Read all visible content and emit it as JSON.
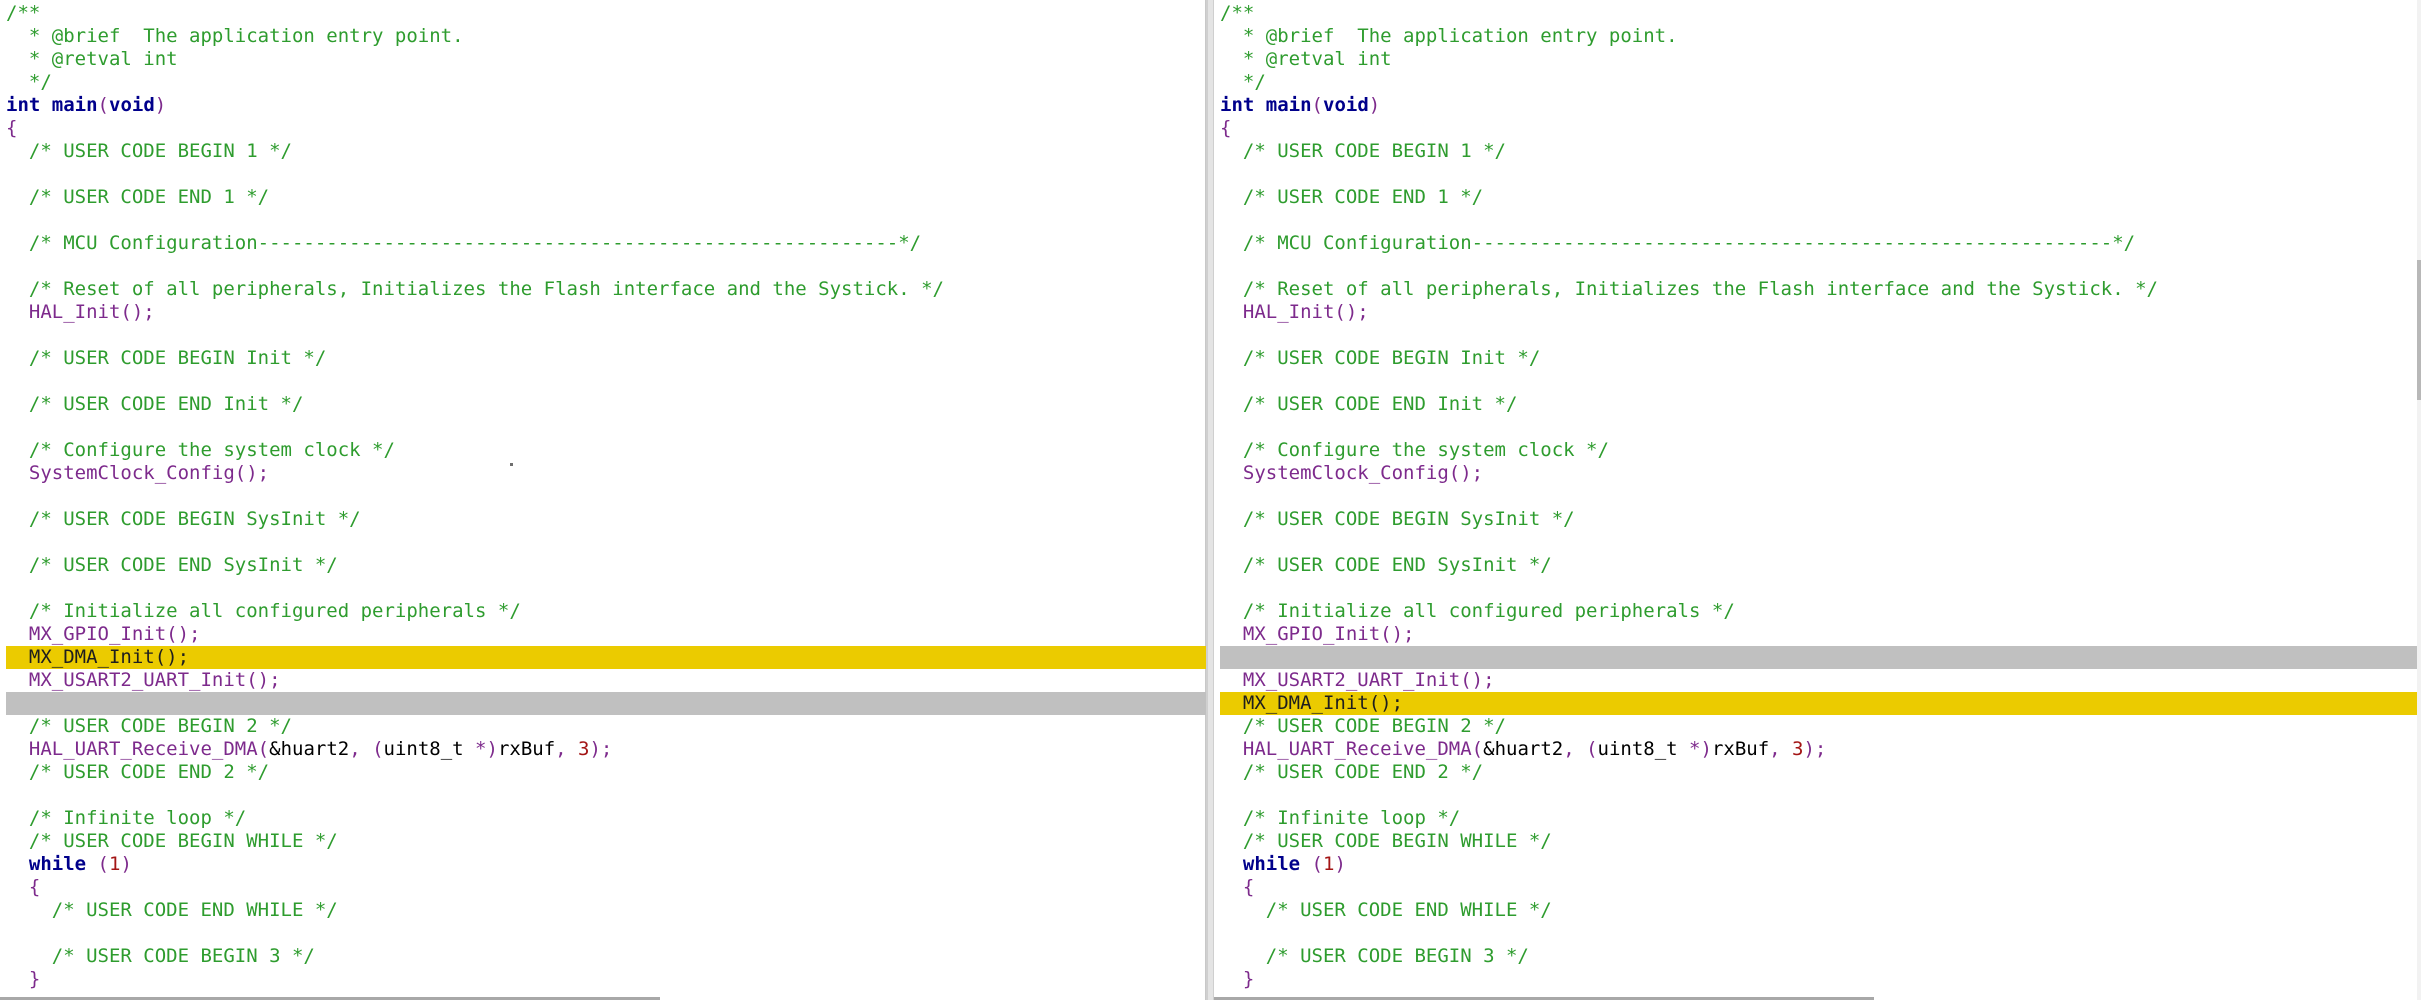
{
  "panes": [
    {
      "id": "left",
      "lines": [
        {
          "type": "normal",
          "tokens": [
            {
              "t": "comment",
              "v": "/**"
            }
          ]
        },
        {
          "type": "normal",
          "tokens": [
            {
              "t": "comment",
              "v": "  * @brief  The application entry point."
            }
          ]
        },
        {
          "type": "normal",
          "tokens": [
            {
              "t": "comment",
              "v": "  * @retval int"
            }
          ]
        },
        {
          "type": "normal",
          "tokens": [
            {
              "t": "comment",
              "v": "  */"
            }
          ]
        },
        {
          "type": "normal",
          "tokens": [
            {
              "t": "keyword",
              "v": "int"
            },
            {
              "t": "plain",
              "v": " "
            },
            {
              "t": "keyword",
              "v": "main"
            },
            {
              "t": "punct",
              "v": "("
            },
            {
              "t": "keyword",
              "v": "void"
            },
            {
              "t": "punct",
              "v": ")"
            }
          ]
        },
        {
          "type": "normal",
          "tokens": [
            {
              "t": "punct",
              "v": "{"
            }
          ]
        },
        {
          "type": "normal",
          "tokens": [
            {
              "t": "comment",
              "v": "  /* USER CODE BEGIN 1 */"
            }
          ]
        },
        {
          "type": "normal",
          "tokens": []
        },
        {
          "type": "normal",
          "tokens": [
            {
              "t": "comment",
              "v": "  /* USER CODE END 1 */"
            }
          ]
        },
        {
          "type": "normal",
          "tokens": []
        },
        {
          "type": "normal",
          "tokens": [
            {
              "t": "comment",
              "v": "  /* MCU Configuration--------------------------------------------------------*/"
            }
          ]
        },
        {
          "type": "normal",
          "tokens": []
        },
        {
          "type": "normal",
          "tokens": [
            {
              "t": "comment",
              "v": "  /* Reset of all peripherals, Initializes the Flash interface and the Systick. */"
            }
          ]
        },
        {
          "type": "normal",
          "tokens": [
            {
              "t": "plain",
              "v": "  "
            },
            {
              "t": "func",
              "v": "HAL_Init"
            },
            {
              "t": "punct",
              "v": "();"
            }
          ]
        },
        {
          "type": "normal",
          "tokens": []
        },
        {
          "type": "normal",
          "tokens": [
            {
              "t": "comment",
              "v": "  /* USER CODE BEGIN Init */"
            }
          ]
        },
        {
          "type": "normal",
          "tokens": []
        },
        {
          "type": "normal",
          "tokens": [
            {
              "t": "comment",
              "v": "  /* USER CODE END Init */"
            }
          ]
        },
        {
          "type": "normal",
          "tokens": []
        },
        {
          "type": "normal",
          "tokens": [
            {
              "t": "comment",
              "v": "  /* Configure the system clock */"
            }
          ]
        },
        {
          "type": "normal",
          "tokens": [
            {
              "t": "plain",
              "v": "  "
            },
            {
              "t": "func",
              "v": "SystemClock_Config"
            },
            {
              "t": "punct",
              "v": "();"
            }
          ]
        },
        {
          "type": "normal",
          "tokens": []
        },
        {
          "type": "normal",
          "tokens": [
            {
              "t": "comment",
              "v": "  /* USER CODE BEGIN SysInit */"
            }
          ]
        },
        {
          "type": "normal",
          "tokens": []
        },
        {
          "type": "normal",
          "tokens": [
            {
              "t": "comment",
              "v": "  /* USER CODE END SysInit */"
            }
          ]
        },
        {
          "type": "normal",
          "tokens": []
        },
        {
          "type": "normal",
          "tokens": [
            {
              "t": "comment",
              "v": "  /* Initialize all configured peripherals */"
            }
          ]
        },
        {
          "type": "normal",
          "tokens": [
            {
              "t": "plain",
              "v": "  "
            },
            {
              "t": "func",
              "v": "MX_GPIO_Init"
            },
            {
              "t": "punct",
              "v": "();"
            }
          ]
        },
        {
          "type": "changed",
          "tokens": [
            {
              "t": "plain",
              "v": "  "
            },
            {
              "t": "func",
              "v": "MX_DMA_Init"
            },
            {
              "t": "punct",
              "v": "();"
            }
          ]
        },
        {
          "type": "normal",
          "tokens": [
            {
              "t": "plain",
              "v": "  "
            },
            {
              "t": "func",
              "v": "MX_USART2_UART_Init"
            },
            {
              "t": "punct",
              "v": "();"
            }
          ]
        },
        {
          "type": "gap",
          "tokens": []
        },
        {
          "type": "normal",
          "tokens": [
            {
              "t": "comment",
              "v": "  /* USER CODE BEGIN 2 */"
            }
          ]
        },
        {
          "type": "normal",
          "tokens": [
            {
              "t": "plain",
              "v": "  "
            },
            {
              "t": "func",
              "v": "HAL_UART_Receive_DMA"
            },
            {
              "t": "punct",
              "v": "("
            },
            {
              "t": "plain",
              "v": "&huart2"
            },
            {
              "t": "punct",
              "v": ", ("
            },
            {
              "t": "plain",
              "v": "uint8_t "
            },
            {
              "t": "punct",
              "v": "*)"
            },
            {
              "t": "plain",
              "v": "rxBuf"
            },
            {
              "t": "punct",
              "v": ", "
            },
            {
              "t": "number",
              "v": "3"
            },
            {
              "t": "punct",
              "v": ");"
            }
          ]
        },
        {
          "type": "normal",
          "tokens": [
            {
              "t": "comment",
              "v": "  /* USER CODE END 2 */"
            }
          ]
        },
        {
          "type": "normal",
          "tokens": []
        },
        {
          "type": "normal",
          "tokens": [
            {
              "t": "comment",
              "v": "  /* Infinite loop */"
            }
          ]
        },
        {
          "type": "normal",
          "tokens": [
            {
              "t": "comment",
              "v": "  /* USER CODE BEGIN WHILE */"
            }
          ]
        },
        {
          "type": "normal",
          "tokens": [
            {
              "t": "plain",
              "v": "  "
            },
            {
              "t": "keyword",
              "v": "while"
            },
            {
              "t": "plain",
              "v": " "
            },
            {
              "t": "punct",
              "v": "("
            },
            {
              "t": "number",
              "v": "1"
            },
            {
              "t": "punct",
              "v": ")"
            }
          ]
        },
        {
          "type": "normal",
          "tokens": [
            {
              "t": "plain",
              "v": "  "
            },
            {
              "t": "punct",
              "v": "{"
            }
          ]
        },
        {
          "type": "normal",
          "tokens": [
            {
              "t": "comment",
              "v": "    /* USER CODE END WHILE */"
            }
          ]
        },
        {
          "type": "normal",
          "tokens": []
        },
        {
          "type": "normal",
          "tokens": [
            {
              "t": "comment",
              "v": "    /* USER CODE BEGIN 3 */"
            }
          ]
        },
        {
          "type": "normal",
          "tokens": [
            {
              "t": "plain",
              "v": "  "
            },
            {
              "t": "punct",
              "v": "}"
            }
          ]
        }
      ]
    },
    {
      "id": "right",
      "lines": [
        {
          "type": "normal",
          "tokens": [
            {
              "t": "comment",
              "v": "/**"
            }
          ]
        },
        {
          "type": "normal",
          "tokens": [
            {
              "t": "comment",
              "v": "  * @brief  The application entry point."
            }
          ]
        },
        {
          "type": "normal",
          "tokens": [
            {
              "t": "comment",
              "v": "  * @retval int"
            }
          ]
        },
        {
          "type": "normal",
          "tokens": [
            {
              "t": "comment",
              "v": "  */"
            }
          ]
        },
        {
          "type": "normal",
          "tokens": [
            {
              "t": "keyword",
              "v": "int"
            },
            {
              "t": "plain",
              "v": " "
            },
            {
              "t": "keyword",
              "v": "main"
            },
            {
              "t": "punct",
              "v": "("
            },
            {
              "t": "keyword",
              "v": "void"
            },
            {
              "t": "punct",
              "v": ")"
            }
          ]
        },
        {
          "type": "normal",
          "tokens": [
            {
              "t": "punct",
              "v": "{"
            }
          ]
        },
        {
          "type": "normal",
          "tokens": [
            {
              "t": "comment",
              "v": "  /* USER CODE BEGIN 1 */"
            }
          ]
        },
        {
          "type": "normal",
          "tokens": []
        },
        {
          "type": "normal",
          "tokens": [
            {
              "t": "comment",
              "v": "  /* USER CODE END 1 */"
            }
          ]
        },
        {
          "type": "normal",
          "tokens": []
        },
        {
          "type": "normal",
          "tokens": [
            {
              "t": "comment",
              "v": "  /* MCU Configuration--------------------------------------------------------*/"
            }
          ]
        },
        {
          "type": "normal",
          "tokens": []
        },
        {
          "type": "normal",
          "tokens": [
            {
              "t": "comment",
              "v": "  /* Reset of all peripherals, Initializes the Flash interface and the Systick. */"
            }
          ]
        },
        {
          "type": "normal",
          "tokens": [
            {
              "t": "plain",
              "v": "  "
            },
            {
              "t": "func",
              "v": "HAL_Init"
            },
            {
              "t": "punct",
              "v": "();"
            }
          ]
        },
        {
          "type": "normal",
          "tokens": []
        },
        {
          "type": "normal",
          "tokens": [
            {
              "t": "comment",
              "v": "  /* USER CODE BEGIN Init */"
            }
          ]
        },
        {
          "type": "normal",
          "tokens": []
        },
        {
          "type": "normal",
          "tokens": [
            {
              "t": "comment",
              "v": "  /* USER CODE END Init */"
            }
          ]
        },
        {
          "type": "normal",
          "tokens": []
        },
        {
          "type": "normal",
          "tokens": [
            {
              "t": "comment",
              "v": "  /* Configure the system clock */"
            }
          ]
        },
        {
          "type": "normal",
          "tokens": [
            {
              "t": "plain",
              "v": "  "
            },
            {
              "t": "func",
              "v": "SystemClock_Config"
            },
            {
              "t": "punct",
              "v": "();"
            }
          ]
        },
        {
          "type": "normal",
          "tokens": []
        },
        {
          "type": "normal",
          "tokens": [
            {
              "t": "comment",
              "v": "  /* USER CODE BEGIN SysInit */"
            }
          ]
        },
        {
          "type": "normal",
          "tokens": []
        },
        {
          "type": "normal",
          "tokens": [
            {
              "t": "comment",
              "v": "  /* USER CODE END SysInit */"
            }
          ]
        },
        {
          "type": "normal",
          "tokens": []
        },
        {
          "type": "normal",
          "tokens": [
            {
              "t": "comment",
              "v": "  /* Initialize all configured peripherals */"
            }
          ]
        },
        {
          "type": "normal",
          "tokens": [
            {
              "t": "plain",
              "v": "  "
            },
            {
              "t": "func",
              "v": "MX_GPIO_Init"
            },
            {
              "t": "punct",
              "v": "();"
            }
          ]
        },
        {
          "type": "gap",
          "tokens": []
        },
        {
          "type": "normal",
          "tokens": [
            {
              "t": "plain",
              "v": "  "
            },
            {
              "t": "func",
              "v": "MX_USART2_UART_Init"
            },
            {
              "t": "punct",
              "v": "();"
            }
          ]
        },
        {
          "type": "changed",
          "tokens": [
            {
              "t": "plain",
              "v": "  "
            },
            {
              "t": "func",
              "v": "MX_DMA_Init"
            },
            {
              "t": "punct",
              "v": "();"
            }
          ]
        },
        {
          "type": "normal",
          "tokens": [
            {
              "t": "comment",
              "v": "  /* USER CODE BEGIN 2 */"
            }
          ]
        },
        {
          "type": "normal",
          "tokens": [
            {
              "t": "plain",
              "v": "  "
            },
            {
              "t": "func",
              "v": "HAL_UART_Receive_DMA"
            },
            {
              "t": "punct",
              "v": "("
            },
            {
              "t": "plain",
              "v": "&huart2"
            },
            {
              "t": "punct",
              "v": ", ("
            },
            {
              "t": "plain",
              "v": "uint8_t "
            },
            {
              "t": "punct",
              "v": "*)"
            },
            {
              "t": "plain",
              "v": "rxBuf"
            },
            {
              "t": "punct",
              "v": ", "
            },
            {
              "t": "number",
              "v": "3"
            },
            {
              "t": "punct",
              "v": ");"
            }
          ]
        },
        {
          "type": "normal",
          "tokens": [
            {
              "t": "comment",
              "v": "  /* USER CODE END 2 */"
            }
          ]
        },
        {
          "type": "normal",
          "tokens": []
        },
        {
          "type": "normal",
          "tokens": [
            {
              "t": "comment",
              "v": "  /* Infinite loop */"
            }
          ]
        },
        {
          "type": "normal",
          "tokens": [
            {
              "t": "comment",
              "v": "  /* USER CODE BEGIN WHILE */"
            }
          ]
        },
        {
          "type": "normal",
          "tokens": [
            {
              "t": "plain",
              "v": "  "
            },
            {
              "t": "keyword",
              "v": "while"
            },
            {
              "t": "plain",
              "v": " "
            },
            {
              "t": "punct",
              "v": "("
            },
            {
              "t": "number",
              "v": "1"
            },
            {
              "t": "punct",
              "v": ")"
            }
          ]
        },
        {
          "type": "normal",
          "tokens": [
            {
              "t": "plain",
              "v": "  "
            },
            {
              "t": "punct",
              "v": "{"
            }
          ]
        },
        {
          "type": "normal",
          "tokens": [
            {
              "t": "comment",
              "v": "    /* USER CODE END WHILE */"
            }
          ]
        },
        {
          "type": "normal",
          "tokens": []
        },
        {
          "type": "normal",
          "tokens": [
            {
              "t": "comment",
              "v": "    /* USER CODE BEGIN 3 */"
            }
          ]
        },
        {
          "type": "normal",
          "tokens": [
            {
              "t": "plain",
              "v": "  "
            },
            {
              "t": "punct",
              "v": "}"
            }
          ]
        }
      ]
    }
  ],
  "colors": {
    "comment": "#2e9c2e",
    "keyword": "#00008b",
    "function": "#7d2a8c",
    "number": "#a31515",
    "changed_line": "#ebcb00",
    "gap_line": "#c0c0c0"
  }
}
